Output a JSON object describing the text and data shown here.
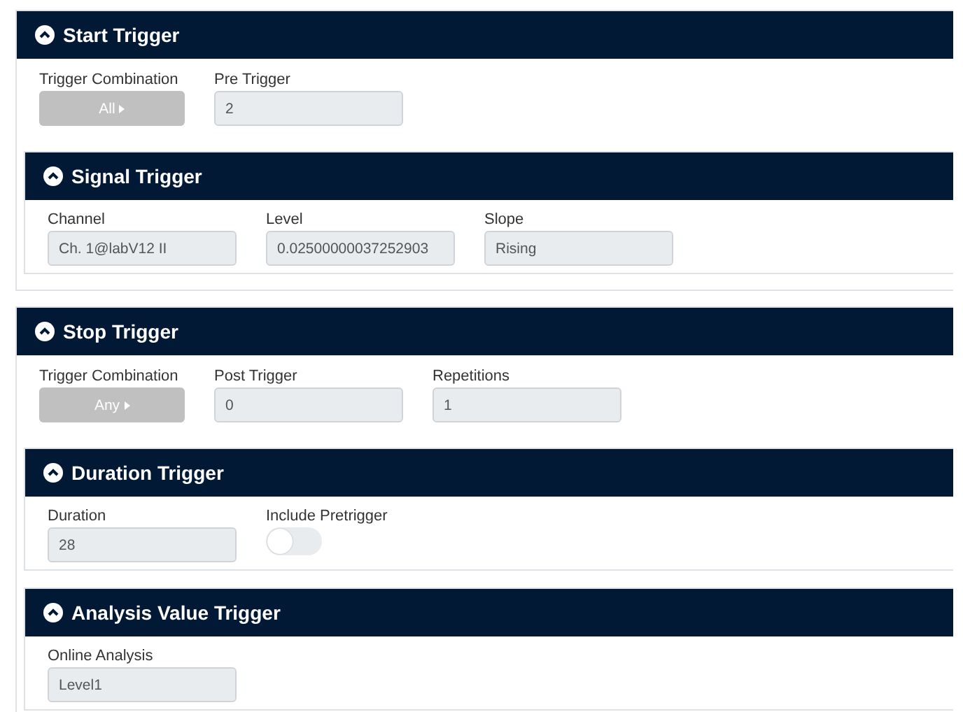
{
  "sections": [
    {
      "title": "Start Trigger",
      "expanded": true,
      "fields": [
        {
          "kind": "combination",
          "label": "Trigger Combination",
          "value": "All"
        },
        {
          "kind": "input",
          "label": "Pre Trigger",
          "value": "2"
        }
      ],
      "subsections": [
        {
          "title": "Signal Trigger",
          "expanded": true,
          "fields": [
            {
              "kind": "input",
              "label": "Channel",
              "value": "Ch. 1@labV12 II"
            },
            {
              "kind": "input",
              "label": "Level",
              "value": "0.02500000037252903"
            },
            {
              "kind": "input",
              "label": "Slope",
              "value": "Rising"
            }
          ]
        }
      ]
    },
    {
      "title": "Stop Trigger",
      "expanded": true,
      "fields": [
        {
          "kind": "combination",
          "label": "Trigger Combination",
          "value": "Any"
        },
        {
          "kind": "input",
          "label": "Post Trigger",
          "value": "0"
        },
        {
          "kind": "input",
          "label": "Repetitions",
          "value": "1"
        }
      ],
      "subsections": [
        {
          "title": "Duration Trigger",
          "expanded": true,
          "fields": [
            {
              "kind": "input",
              "label": "Duration",
              "value": "28"
            },
            {
              "kind": "toggle",
              "label": "Include Pretrigger",
              "on": false
            }
          ]
        },
        {
          "title": "Analysis Value Trigger",
          "expanded": true,
          "fields": [
            {
              "kind": "input",
              "label": "Online Analysis",
              "value": "Level1"
            }
          ]
        }
      ]
    }
  ]
}
